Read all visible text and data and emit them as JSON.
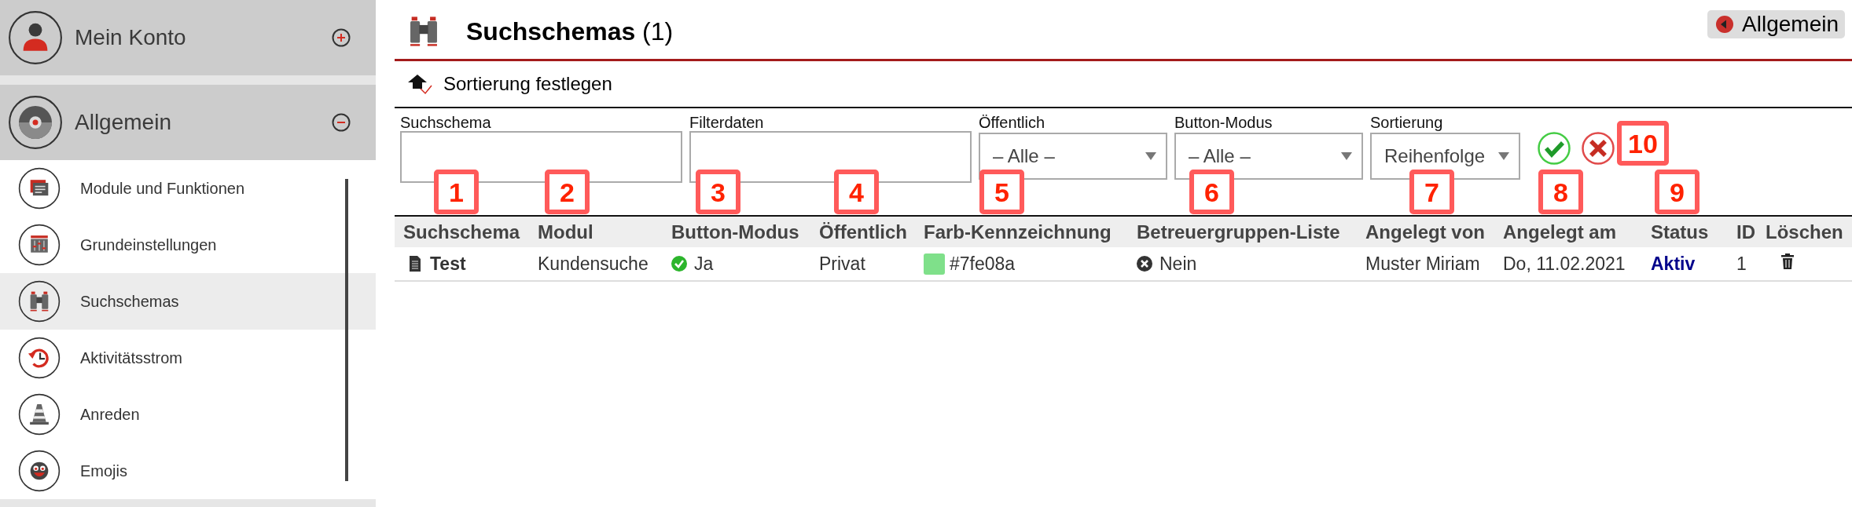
{
  "sidebar": {
    "sections": [
      {
        "title": "Mein Konto",
        "expanded": false
      },
      {
        "title": "Allgemein",
        "expanded": true,
        "items": [
          {
            "label": "Module und Funktionen",
            "selected": false
          },
          {
            "label": "Grundeinstellungen",
            "selected": false
          },
          {
            "label": "Suchschemas",
            "selected": true
          },
          {
            "label": "Aktivitätsstrom",
            "selected": false
          },
          {
            "label": "Anreden",
            "selected": false
          },
          {
            "label": "Emojis",
            "selected": false
          }
        ]
      }
    ]
  },
  "header": {
    "title": "**Suchschemas** (1)",
    "back_button": "Allgemein"
  },
  "toolbar": {
    "sort_link": "Sortierung festlegen"
  },
  "filters": [
    {
      "label": "Suchschema",
      "kind": "text"
    },
    {
      "label": "Filterdaten",
      "kind": "text"
    },
    {
      "label": "Öffentlich",
      "kind": "select",
      "value": "– Alle –"
    },
    {
      "label": "Button-Modus",
      "kind": "select",
      "value": "– Alle –"
    },
    {
      "label": "Sortierung",
      "kind": "select",
      "value": "Reihenfolge"
    }
  ],
  "table": {
    "columns": [
      "Suchschema",
      "Modul",
      "Button-Modus",
      "Öffentlich",
      "Farb-Kennzeichnung",
      "Betreuergruppen-Liste",
      "Angelegt von",
      "Angelegt am",
      "Status",
      "ID",
      "Löschen"
    ],
    "rows": [
      {
        "name": "Test",
        "module": "Kundensuche",
        "button_mode": {
          "label": "Ja",
          "enabled": true
        },
        "visibility": "Privat",
        "color": "#7fe08a",
        "color_code": "#7fe08a",
        "group_list": {
          "label": "Nein",
          "enabled": false
        },
        "created_by": "Muster Miriam",
        "created_on": "Do, 11.02.2021",
        "status": "Aktiv",
        "id": "1"
      }
    ]
  },
  "callouts": [
    "1",
    "2",
    "3",
    "4",
    "5",
    "6",
    "7",
    "8",
    "9",
    "10"
  ]
}
